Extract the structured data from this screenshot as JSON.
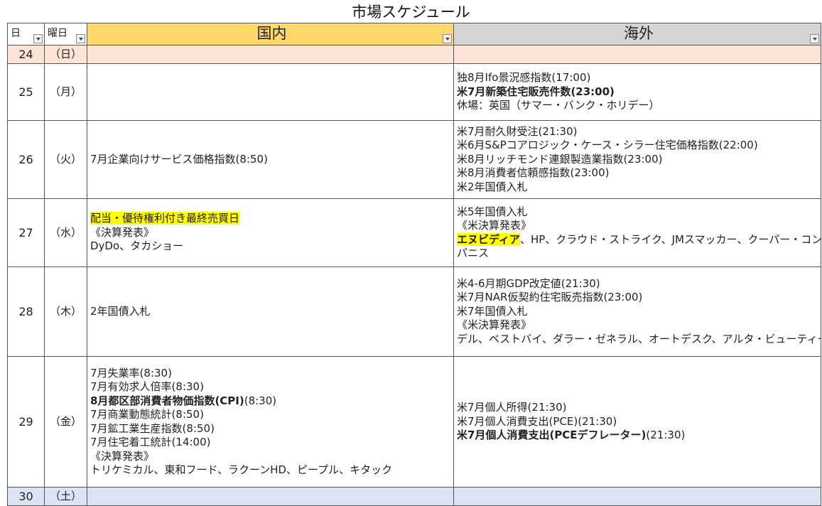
{
  "title": "市場スケジュール",
  "headers": {
    "day": "日",
    "weekday": "曜日",
    "domestic": "国内",
    "foreign": "海外"
  },
  "rows": [
    {
      "day": "24",
      "weekday": "（日）",
      "domestic": [],
      "foreign": []
    },
    {
      "day": "25",
      "weekday": "（月）",
      "domestic": [],
      "foreign": [
        "独8月Ifo景況感指数(17:00)",
        "米7月新築住宅販売件数(23:00)",
        "休場：英国（サマー・バンク・ホリデー）"
      ]
    },
    {
      "day": "26",
      "weekday": "（火）",
      "domestic": [
        "7月企業向けサービス価格指数(8:50)"
      ],
      "foreign": [
        "米7月耐久財受注(21:30)",
        "米6月S&Pコアロジック・ケース・シラー住宅価格指数(22:00)",
        "米8月リッチモンド連銀製造業指数(23:00)",
        "米8月消費者信頼感指数(23:00)",
        "米2年国債入札"
      ]
    },
    {
      "day": "27",
      "weekday": "（水）",
      "domestic": [
        "配当・優待権利付き最終売買日",
        "《決算発表》",
        "DyDo、タカショー"
      ],
      "foreign": [
        "米5年国債入札",
        "《米決算発表》",
        "エヌビディア",
        "、HP、クラウド・ストライク、JMスマッカー、クーパー・コン",
        "パニス"
      ]
    },
    {
      "day": "28",
      "weekday": "（木）",
      "domestic": [
        "2年国債入札"
      ],
      "foreign": [
        "米4-6月期GDP改定値(21:30)",
        "米7月NAR仮契約住宅販売指数(23:00)",
        "米7年国債入札",
        "《米決算発表》",
        "デル、ベストバイ、ダラー・ゼネラル、オートデスク、アルタ・ビューティー"
      ]
    },
    {
      "day": "29",
      "weekday": "（金）",
      "domestic": [
        "7月失業率(8:30)",
        "7月有効求人倍率(8:30)",
        "8月都区部消費者物価指数(CPI)",
        "(8:30)",
        "7月商業動態統計(8:50)",
        "7月鉱工業生産指数(8:50)",
        "7月住宅着工統計(14:00)",
        "《決算発表》",
        "トリケミカル、東和フード、ラクーンHD、ピープル、キタック"
      ],
      "foreign": [
        "米7月個人所得(21:30)",
        "米7月個人消費支出(PCE)(21:30)",
        "米7月個人消費支出(PCEデフレーター)",
        "(21:30)"
      ]
    },
    {
      "day": "30",
      "weekday": "（土）",
      "domestic": [],
      "foreign": []
    }
  ]
}
